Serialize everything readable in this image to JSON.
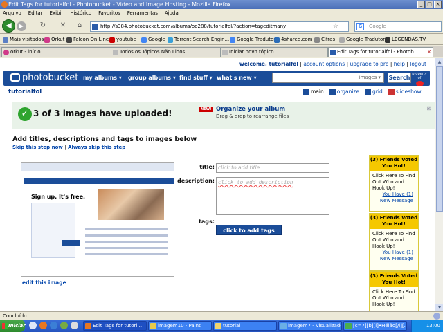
{
  "window": {
    "title": "Edit Tags for tutorialfol - Photobucket - Video and Image Hosting - Mozilla Firefox"
  },
  "menu": [
    "Arquivo",
    "Editar",
    "Exibir",
    "Histórico",
    "Favoritos",
    "Ferramentas",
    "Ajuda"
  ],
  "nav": {
    "url": "http://s384.photobucket.com/albums/oo288/tutorialfol/?action=tageditmany",
    "search_placeholder": "Google",
    "search_letter": "G"
  },
  "bookmarks": [
    "Mais visitados",
    "Orkut",
    "Falcon On Line",
    "youtube",
    "Google",
    "Torrent Search Engin...",
    "Google Tradutor",
    "4shared.com",
    "Cifras",
    "Google Tradutor",
    "LEGENDAS.TV"
  ],
  "tabs": [
    "orkut - início",
    "Todos os Tópicos Não Lidos",
    "Iniciar novo tópico",
    "Edit Tags for tutorialfol - Photob..."
  ],
  "pb": {
    "welcome": "welcome, tutorialfol",
    "top_links": [
      "account options",
      "upgrade to pro",
      "help",
      "logout"
    ],
    "logo": "photobucket",
    "nav": [
      "my albums ▾",
      "group albums ▾",
      "find stuff ▾",
      "what's new ▾"
    ],
    "search_placeholder": "images ▾",
    "search_button": "Search",
    "brand_small": "property of",
    "username": "tutorialfol",
    "view_links": [
      "main",
      "organize",
      "grid",
      "slideshow"
    ]
  },
  "upload": {
    "message": "3 of 3 images have uploaded!",
    "badge": "NEW!",
    "organize_title": "Organize your album",
    "organize_sub": "Drag & drop to rearrange files"
  },
  "editor": {
    "heading": "Add titles, descriptions and tags to images below",
    "skip": "Skip this step now",
    "skip_sep": "|",
    "always_skip": "Always skip this step",
    "title_label": "title:",
    "title_placeholder": "click to add title",
    "desc_label": "description:",
    "desc_placeholder": "click to add description",
    "tags_label": "tags:",
    "tags_button": "click to add tags",
    "edit_link": "edit this image",
    "thumb_signup": "Sign up. It's free."
  },
  "ads": [
    {
      "head": "(3) Friends Voted You Hot!",
      "body": "Click Here To Find Out Who and Hook Up!",
      "link1": "You Have (1)",
      "link2": "New Message"
    },
    {
      "head": "(3) Friends Voted You Hot!",
      "body": "Click Here To Find Out Who and Hook Up!",
      "link1": "You Have (1)",
      "link2": "New Message"
    },
    {
      "head": "(3) Friends Voted You Hot!",
      "body": "Click Here To Find Out Who and Hook Up!"
    }
  ],
  "status": "Concluído",
  "taskbar": {
    "start": "Iniciar",
    "items": [
      "Edit Tags for tutori...",
      "imagem10 - Paint",
      "tutorial",
      "imagem7 - Visualizado...",
      "[c=7][b][i]•Hélão[/i][..."
    ],
    "clock": "13:00"
  }
}
